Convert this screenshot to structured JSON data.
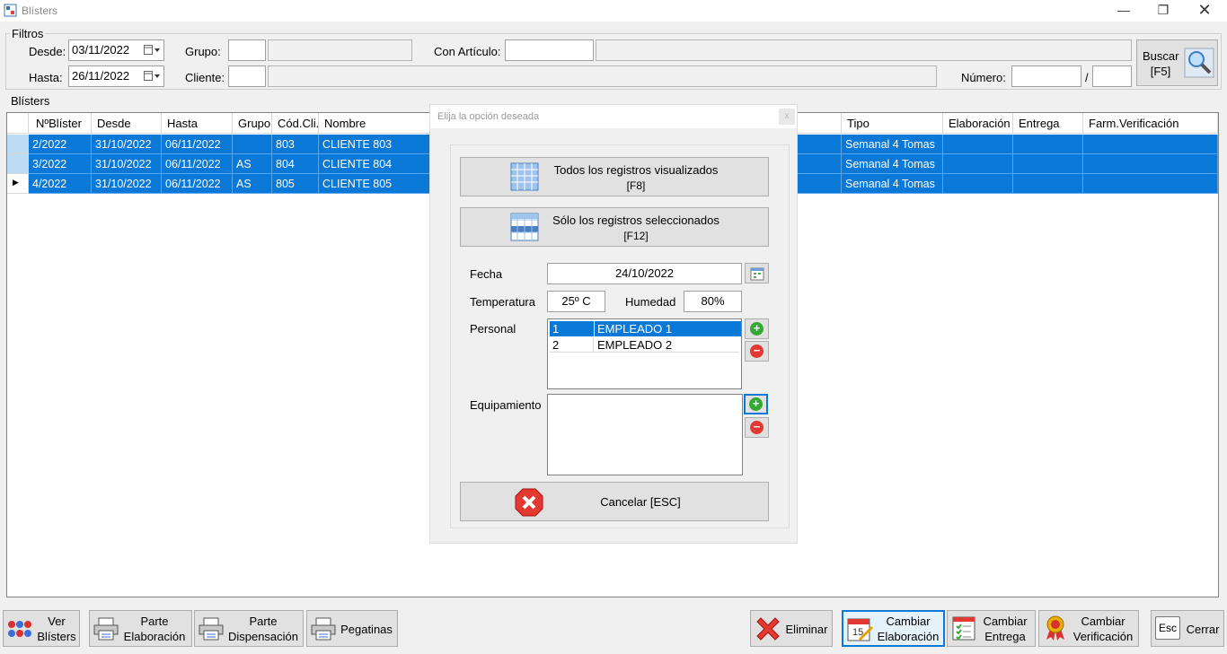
{
  "window": {
    "title": "Blísters"
  },
  "filters": {
    "legend": "Filtros",
    "desde_label": "Desde:",
    "desde_value": "03/11/2022",
    "hasta_label": "Hasta:",
    "hasta_value": "26/11/2022",
    "grupo_label": "Grupo:",
    "cliente_label": "Cliente:",
    "articulo_label": "Con Artículo:",
    "numero_label": "Número:",
    "numero_sep": "/",
    "buscar_label": "Buscar",
    "buscar_key": "[F5]"
  },
  "grid": {
    "legend": "Blísters",
    "columns": [
      "NºBlíster",
      "Desde",
      "Hasta",
      "Grupo",
      "Cód.Cli.",
      "Nombre",
      "Tipo",
      "Elaboración",
      "Entrega",
      "Farm.Verificación"
    ],
    "rows": [
      {
        "num": "2/2022",
        "desde": "31/10/2022",
        "hasta": "06/11/2022",
        "grupo": "",
        "cod": "803",
        "nombre": "CLIENTE 803",
        "tipo": "Semanal 4 Tomas"
      },
      {
        "num": "3/2022",
        "desde": "31/10/2022",
        "hasta": "06/11/2022",
        "grupo": "AS",
        "cod": "804",
        "nombre": "CLIENTE 804",
        "tipo": "Semanal 4 Tomas"
      },
      {
        "num": "4/2022",
        "desde": "31/10/2022",
        "hasta": "06/11/2022",
        "grupo": "AS",
        "cod": "805",
        "nombre": "CLIENTE 805",
        "tipo": "Semanal 4 Tomas"
      }
    ],
    "current_row_marker": "▶"
  },
  "dialog": {
    "title": "Elija la opción deseada",
    "close": "x",
    "todos_label": "Todos los registros visualizados",
    "todos_key": "[F8]",
    "solo_label": "Sólo los registros seleccionados",
    "solo_key": "[F12]",
    "fecha_label": "Fecha",
    "fecha_value": "24/10/2022",
    "temperatura_label": "Temperatura",
    "temperatura_value": "25º C",
    "humedad_label": "Humedad",
    "humedad_value": "80%",
    "personal_label": "Personal",
    "personal": [
      {
        "id": "1",
        "name": "EMPLEADO 1"
      },
      {
        "id": "2",
        "name": "EMPLEADO 2"
      }
    ],
    "equipamiento_label": "Equipamiento",
    "cancelar_label": "Cancelar [ESC]"
  },
  "toolbar": {
    "ver_line1": "Ver",
    "ver_line2": "Blísters",
    "parte_elab_line1": "Parte",
    "parte_elab_line2": "Elaboración",
    "parte_disp_line1": "Parte",
    "parte_disp_line2": "Dispensación",
    "pegatinas": "Pegatinas",
    "eliminar": "Eliminar",
    "cambiar_elab_line1": "Cambiar",
    "cambiar_elab_line2": "Elaboración",
    "cambiar_entrega_line1": "Cambiar",
    "cambiar_entrega_line2": "Entrega",
    "cambiar_verif_line1": "Cambiar",
    "cambiar_verif_line2": "Verificación",
    "esc_key": "Esc",
    "cerrar": "Cerrar",
    "calendar_day": "15"
  },
  "colors": {
    "selection": "#0a78d7",
    "accent_red": "#e23a32",
    "accent_green": "#35a935"
  }
}
